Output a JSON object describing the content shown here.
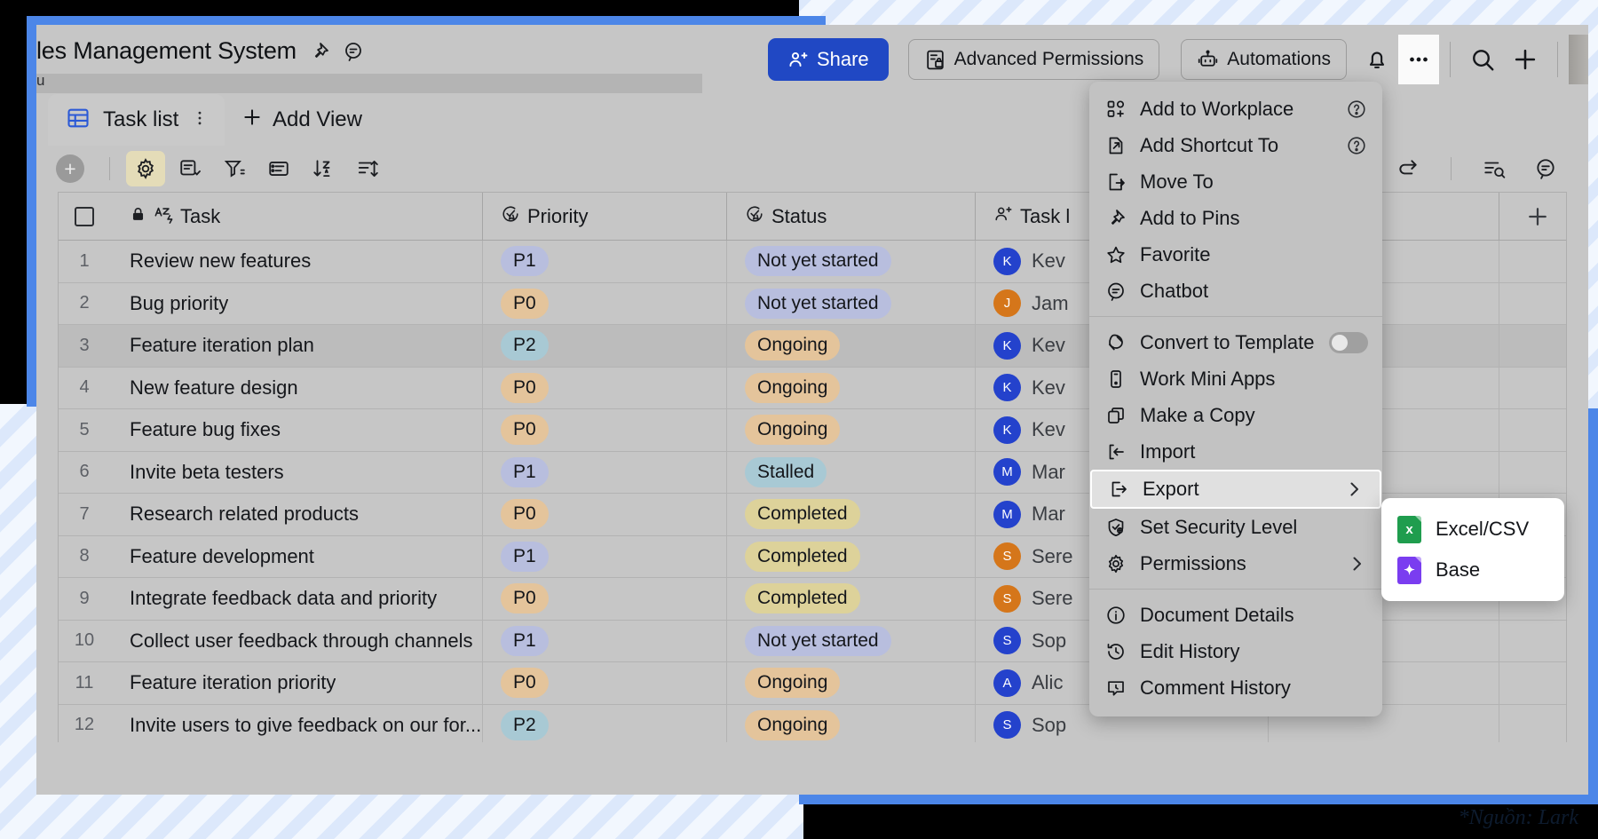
{
  "window": {
    "doc_title": "les Management System",
    "breadcrumb": "u"
  },
  "header": {
    "share_label": "Share",
    "advanced_permissions_label": "Advanced Permissions",
    "automations_label": "Automations",
    "bell_icon": "bell-icon",
    "more_icon": "ellipsis-icon",
    "search_icon": "search-icon",
    "plus_icon": "plus-icon",
    "pin_icon": "pin-icon",
    "comment_icon": "comment-icon"
  },
  "tabs": {
    "active_tab": "Task list",
    "tab_more_icon": "kebab-icon",
    "add_view_label": "Add View",
    "add_view_icon": "plus-icon"
  },
  "toolbar": {
    "add_record_icon": "plus-icon",
    "items": [
      {
        "name": "field-settings-icon",
        "active": true
      },
      {
        "name": "group-icon",
        "active": false
      },
      {
        "name": "filter-icon",
        "active": false
      },
      {
        "name": "row-height-icon",
        "active": false
      },
      {
        "name": "sort-az-icon",
        "active": false
      },
      {
        "name": "sort-icon",
        "active": false
      }
    ],
    "right_items": [
      {
        "name": "redo-icon"
      },
      {
        "name": "search-record-icon"
      },
      {
        "name": "comment-icon"
      }
    ]
  },
  "grid": {
    "columns": [
      {
        "key": "task",
        "label": "Task",
        "icon": "text-field-icon",
        "locked": true
      },
      {
        "key": "priority",
        "label": "Priority",
        "icon": "single-select-icon"
      },
      {
        "key": "status",
        "label": "Status",
        "icon": "single-select-icon"
      },
      {
        "key": "lead",
        "label": "Task l",
        "icon": "person-icon"
      }
    ],
    "add_column_icon": "plus-icon",
    "select_all_icon": "checkbox-icon",
    "rows": [
      {
        "n": "1",
        "task": "Review new features",
        "priority": "P1",
        "status": "Not yet started",
        "lead": "Kev",
        "initial": "K",
        "avatar": "#2442cc",
        "selected": false
      },
      {
        "n": "2",
        "task": "Bug priority",
        "priority": "P0",
        "status": "Not yet started",
        "lead": "Jam",
        "initial": "J",
        "avatar": "#d5761a",
        "selected": false
      },
      {
        "n": "3",
        "task": "Feature iteration plan",
        "priority": "P2",
        "status": "Ongoing",
        "lead": "Kev",
        "initial": "K",
        "avatar": "#2442cc",
        "selected": true
      },
      {
        "n": "4",
        "task": "New feature design",
        "priority": "P0",
        "status": "Ongoing",
        "lead": "Kev",
        "initial": "K",
        "avatar": "#2442cc",
        "selected": false
      },
      {
        "n": "5",
        "task": "Feature bug fixes",
        "priority": "P0",
        "status": "Ongoing",
        "lead": "Kev",
        "initial": "K",
        "avatar": "#2442cc",
        "selected": false
      },
      {
        "n": "6",
        "task": "Invite beta testers",
        "priority": "P1",
        "status": "Stalled",
        "lead": "Mar",
        "initial": "M",
        "avatar": "#2442cc",
        "selected": false
      },
      {
        "n": "7",
        "task": "Research related products",
        "priority": "P0",
        "status": "Completed",
        "lead": "Mar",
        "initial": "M",
        "avatar": "#2442cc",
        "selected": false
      },
      {
        "n": "8",
        "task": "Feature development",
        "priority": "P1",
        "status": "Completed",
        "lead": "Sere",
        "initial": "S",
        "avatar": "#d5761a",
        "selected": false
      },
      {
        "n": "9",
        "task": "Integrate feedback data and priority",
        "priority": "P0",
        "status": "Completed",
        "lead": "Sere",
        "initial": "S",
        "avatar": "#d5761a",
        "selected": false
      },
      {
        "n": "10",
        "task": "Collect user feedback through channels",
        "priority": "P1",
        "status": "Not yet started",
        "lead": "Sop",
        "initial": "S",
        "avatar": "#2442cc",
        "selected": false
      },
      {
        "n": "11",
        "task": "Feature iteration priority",
        "priority": "P0",
        "status": "Ongoing",
        "lead": "Alic",
        "initial": "A",
        "avatar": "#2442cc",
        "selected": false
      },
      {
        "n": "12",
        "task": "Invite users to give feedback on our for...",
        "priority": "P2",
        "status": "Ongoing",
        "lead": "Sop",
        "initial": "S",
        "avatar": "#2442cc",
        "selected": false
      }
    ]
  },
  "chip_colors": {
    "P0": "#e4c49b",
    "P1": "#b8bede",
    "P2": "#a8c9d4",
    "Not yet started": "#b8bede",
    "Ongoing": "#e4c49b",
    "Completed": "#ddd29a",
    "Stalled": "#a8c9d4"
  },
  "menu": {
    "groups": [
      {
        "items": [
          {
            "label": "Add to Workplace",
            "icon": "add-to-workplace-icon",
            "trailing": "help"
          },
          {
            "label": "Add Shortcut To",
            "icon": "shortcut-icon",
            "trailing": "help"
          },
          {
            "label": "Move To",
            "icon": "move-to-icon",
            "trailing": ""
          },
          {
            "label": "Add to Pins",
            "icon": "pin-icon",
            "trailing": ""
          },
          {
            "label": "Favorite",
            "icon": "star-icon",
            "trailing": ""
          },
          {
            "label": "Chatbot",
            "icon": "chatbot-icon",
            "trailing": ""
          }
        ]
      },
      {
        "items": [
          {
            "label": "Convert to Template",
            "icon": "template-icon",
            "trailing": "toggle"
          },
          {
            "label": "Work Mini Apps",
            "icon": "mini-apps-icon",
            "trailing": ""
          },
          {
            "label": "Make a Copy",
            "icon": "copy-icon",
            "trailing": ""
          },
          {
            "label": "Import",
            "icon": "import-icon",
            "trailing": ""
          },
          {
            "label": "Export",
            "icon": "export-icon",
            "trailing": "chevron",
            "highlighted": true
          },
          {
            "label": "Set Security Level",
            "icon": "shield-icon",
            "trailing": ""
          },
          {
            "label": "Permissions",
            "icon": "gear-icon",
            "trailing": "chevron"
          }
        ]
      },
      {
        "items": [
          {
            "label": "Document Details",
            "icon": "info-icon",
            "trailing": ""
          },
          {
            "label": "Edit History",
            "icon": "history-icon",
            "trailing": ""
          },
          {
            "label": "Comment History",
            "icon": "comment-history-icon",
            "trailing": ""
          }
        ]
      }
    ]
  },
  "submenu": {
    "items": [
      {
        "label": "Excel/CSV",
        "icon": "excel-file-icon",
        "color": "#1f9d4e",
        "glyph": "x"
      },
      {
        "label": "Base",
        "icon": "base-file-icon",
        "color": "#7a3df0",
        "glyph": "✦"
      }
    ]
  },
  "watermark": {
    "text": "*Nguồn: Lark"
  }
}
